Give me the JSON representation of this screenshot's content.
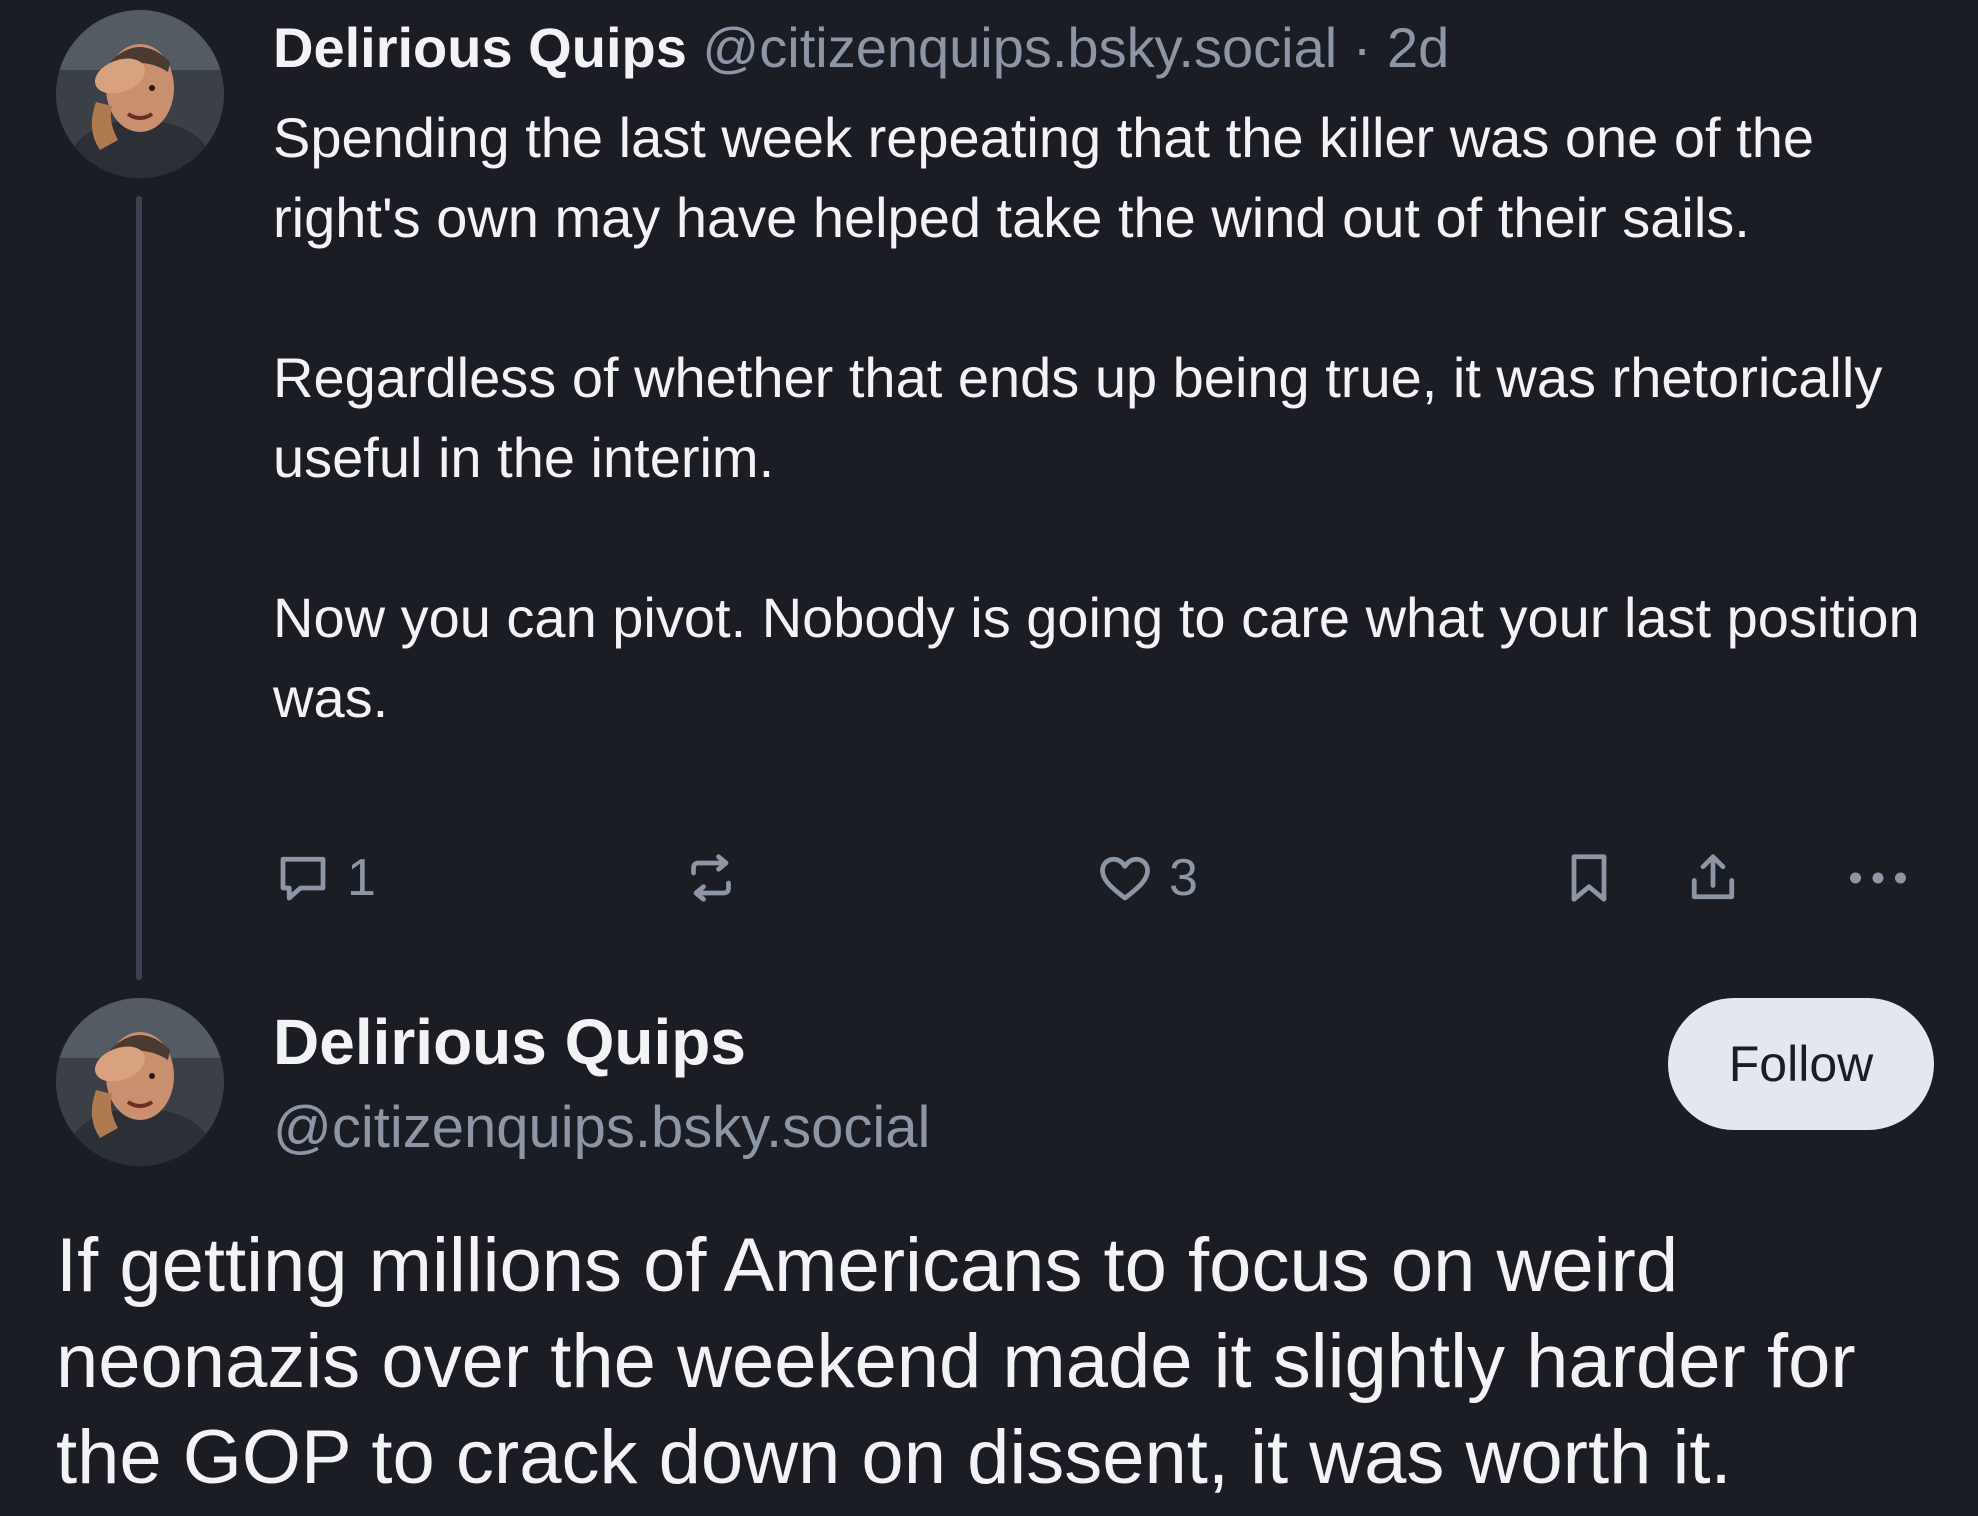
{
  "colors": {
    "background": "#1a1d24",
    "text": "#f1f3f5",
    "muted": "#8d96a5",
    "thread_line": "#3a4150",
    "follow_button_bg": "#e3e7ee"
  },
  "reply_post": {
    "author_name": "Delirious Quips",
    "handle": "@citizenquips.bsky.social",
    "separator": "·",
    "timestamp": "2d",
    "avatar_icon": "person-facepalm-avatar",
    "paragraphs": [
      "Spending the last week repeating that the killer was one of the right's own may have helped take the wind out of their sails.",
      "Regardless of whether that ends up being true, it was rhetorically useful in the interim.",
      "Now you can pivot. Nobody is going to care what your last position was."
    ],
    "actions": {
      "reply_icon": "speech-bubble-icon",
      "reply_count": "1",
      "repost_icon": "repost-icon",
      "like_icon": "heart-icon",
      "like_count": "3",
      "bookmark_icon": "bookmark-icon",
      "share_icon": "share-icon",
      "more_icon": "ellipsis-icon"
    }
  },
  "main_post": {
    "author_name": "Delirious Quips",
    "handle": "@citizenquips.bsky.social",
    "avatar_icon": "person-facepalm-avatar",
    "follow_label": "Follow",
    "text": "If getting millions of Americans to focus on weird neonazis over the weekend made it slightly harder for the GOP to crack down on dissent, it was worth it."
  }
}
